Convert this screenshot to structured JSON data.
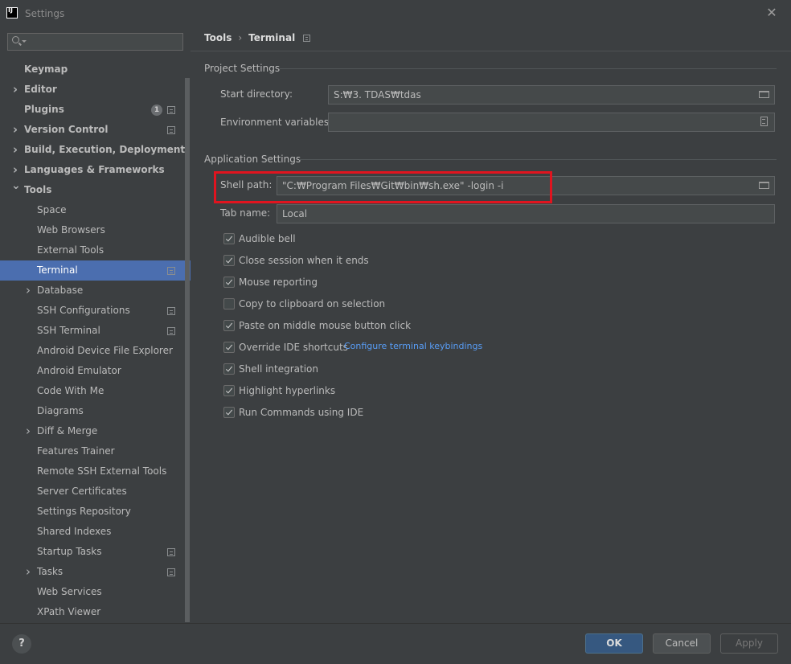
{
  "window": {
    "title": "Settings"
  },
  "search": {
    "placeholder": "",
    "value": ""
  },
  "sidebar": {
    "items": [
      {
        "label": "Keymap",
        "bold": true,
        "level": 0,
        "expander": "",
        "badge": "",
        "count": ""
      },
      {
        "label": "Editor",
        "bold": true,
        "level": 0,
        "expander": "right",
        "badge": "",
        "count": ""
      },
      {
        "label": "Plugins",
        "bold": true,
        "level": 0,
        "expander": "",
        "badge": "project",
        "count": "1"
      },
      {
        "label": "Version Control",
        "bold": true,
        "level": 0,
        "expander": "right",
        "badge": "project",
        "count": ""
      },
      {
        "label": "Build, Execution, Deployment",
        "bold": true,
        "level": 0,
        "expander": "right",
        "badge": "",
        "count": ""
      },
      {
        "label": "Languages & Frameworks",
        "bold": true,
        "level": 0,
        "expander": "right",
        "badge": "",
        "count": ""
      },
      {
        "label": "Tools",
        "bold": true,
        "level": 0,
        "expander": "down",
        "badge": "",
        "count": ""
      },
      {
        "label": "Space",
        "bold": false,
        "level": 1,
        "expander": "",
        "badge": "",
        "count": ""
      },
      {
        "label": "Web Browsers",
        "bold": false,
        "level": 1,
        "expander": "",
        "badge": "",
        "count": ""
      },
      {
        "label": "External Tools",
        "bold": false,
        "level": 1,
        "expander": "",
        "badge": "",
        "count": ""
      },
      {
        "label": "Terminal",
        "bold": false,
        "level": 1,
        "expander": "",
        "badge": "project",
        "count": "",
        "selected": true
      },
      {
        "label": "Database",
        "bold": false,
        "level": 1,
        "expander": "right",
        "badge": "",
        "count": ""
      },
      {
        "label": "SSH Configurations",
        "bold": false,
        "level": 1,
        "expander": "",
        "badge": "project",
        "count": ""
      },
      {
        "label": "SSH Terminal",
        "bold": false,
        "level": 1,
        "expander": "",
        "badge": "project",
        "count": ""
      },
      {
        "label": "Android Device File Explorer",
        "bold": false,
        "level": 1,
        "expander": "",
        "badge": "",
        "count": ""
      },
      {
        "label": "Android Emulator",
        "bold": false,
        "level": 1,
        "expander": "",
        "badge": "",
        "count": ""
      },
      {
        "label": "Code With Me",
        "bold": false,
        "level": 1,
        "expander": "",
        "badge": "",
        "count": ""
      },
      {
        "label": "Diagrams",
        "bold": false,
        "level": 1,
        "expander": "",
        "badge": "",
        "count": ""
      },
      {
        "label": "Diff & Merge",
        "bold": false,
        "level": 1,
        "expander": "right",
        "badge": "",
        "count": ""
      },
      {
        "label": "Features Trainer",
        "bold": false,
        "level": 1,
        "expander": "",
        "badge": "",
        "count": ""
      },
      {
        "label": "Remote SSH External Tools",
        "bold": false,
        "level": 1,
        "expander": "",
        "badge": "",
        "count": ""
      },
      {
        "label": "Server Certificates",
        "bold": false,
        "level": 1,
        "expander": "",
        "badge": "",
        "count": ""
      },
      {
        "label": "Settings Repository",
        "bold": false,
        "level": 1,
        "expander": "",
        "badge": "",
        "count": ""
      },
      {
        "label": "Shared Indexes",
        "bold": false,
        "level": 1,
        "expander": "",
        "badge": "",
        "count": ""
      },
      {
        "label": "Startup Tasks",
        "bold": false,
        "level": 1,
        "expander": "",
        "badge": "project",
        "count": ""
      },
      {
        "label": "Tasks",
        "bold": false,
        "level": 1,
        "expander": "right",
        "badge": "project",
        "count": ""
      },
      {
        "label": "Web Services",
        "bold": false,
        "level": 1,
        "expander": "",
        "badge": "",
        "count": ""
      },
      {
        "label": "XPath Viewer",
        "bold": false,
        "level": 1,
        "expander": "",
        "badge": "",
        "count": ""
      }
    ]
  },
  "breadcrumb": {
    "parent": "Tools",
    "separator": "›",
    "current": "Terminal"
  },
  "project_settings": {
    "heading": "Project Settings",
    "start_directory": {
      "label": "Start directory:",
      "value": "S:₩3. TDAS₩tdas"
    },
    "environment_variables": {
      "label": "Environment variables:",
      "value": ""
    }
  },
  "application_settings": {
    "heading": "Application Settings",
    "shell_path": {
      "label": "Shell path:",
      "value": "\"C:₩Program Files₩Git₩bin₩sh.exe\" -login -i"
    },
    "tab_name": {
      "label": "Tab name:",
      "value": "Local"
    },
    "checkboxes": [
      {
        "label": "Audible bell",
        "checked": true
      },
      {
        "label": "Close session when it ends",
        "checked": true
      },
      {
        "label": "Mouse reporting",
        "checked": true
      },
      {
        "label": "Copy to clipboard on selection",
        "checked": false
      },
      {
        "label": "Paste on middle mouse button click",
        "checked": true
      },
      {
        "label": "Override IDE shortcuts",
        "checked": true
      },
      {
        "label": "Shell integration",
        "checked": true
      },
      {
        "label": "Highlight hyperlinks",
        "checked": true
      },
      {
        "label": "Run Commands using IDE",
        "checked": true
      }
    ],
    "keybindings_link": "Configure terminal keybindings"
  },
  "buttons": {
    "ok": "OK",
    "cancel": "Cancel",
    "apply": "Apply",
    "help": "?"
  },
  "colors": {
    "accent": "#4b6eaf",
    "highlight_box": "#e0141f",
    "link": "#589df6",
    "background": "#3c3f41"
  }
}
